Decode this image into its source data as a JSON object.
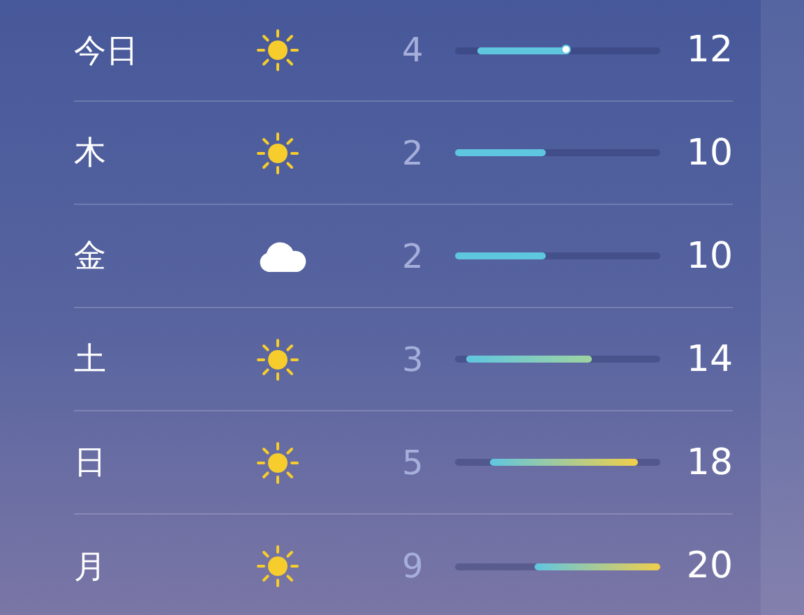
{
  "forecast": [
    {
      "day": "今日",
      "kind": "sun",
      "low": "4",
      "high": "12",
      "now_marker": true
    },
    {
      "day": "木",
      "kind": "sun",
      "low": "2",
      "high": "10",
      "now_marker": false
    },
    {
      "day": "金",
      "kind": "cloud",
      "low": "2",
      "high": "10",
      "now_marker": false
    },
    {
      "day": "土",
      "kind": "sun",
      "low": "3",
      "high": "14",
      "now_marker": false
    },
    {
      "day": "日",
      "kind": "sun",
      "low": "5",
      "high": "18",
      "now_marker": false
    },
    {
      "day": "月",
      "kind": "sun",
      "low": "9",
      "high": "20",
      "now_marker": false
    }
  ]
}
